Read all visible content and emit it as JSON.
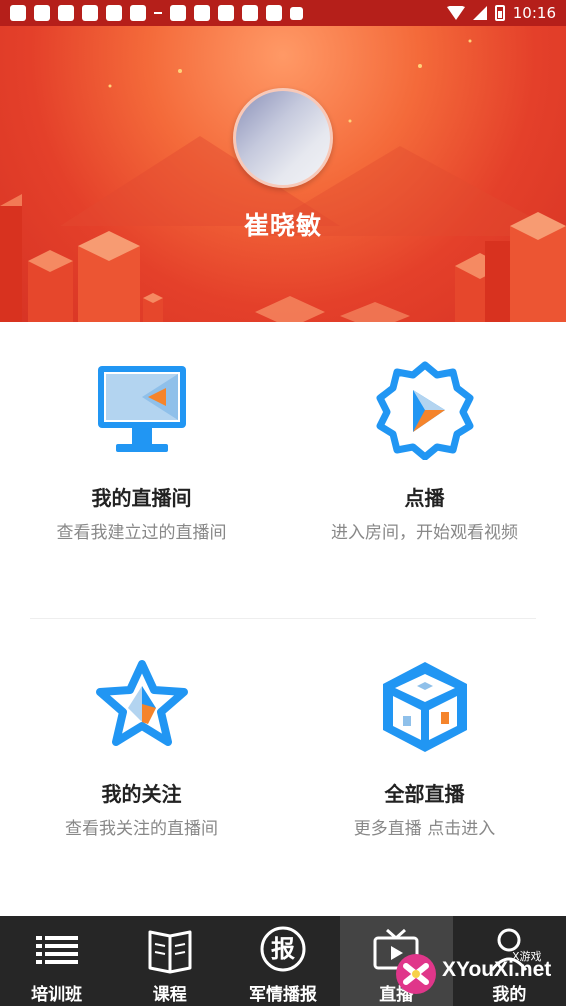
{
  "status_bar": {
    "time": "10:16"
  },
  "profile": {
    "user_name": "崔晓敏"
  },
  "grid": [
    {
      "title": "我的直播间",
      "subtitle": "查看我建立过的直播间",
      "icon": "monitor-icon"
    },
    {
      "title": "点播",
      "subtitle": "进入房间，开始观看视频",
      "icon": "play-badge-icon"
    },
    {
      "title": "我的关注",
      "subtitle": "查看我关注的直播间",
      "icon": "star-icon"
    },
    {
      "title": "全部直播",
      "subtitle": "更多直播 点击进入",
      "icon": "cube-icon"
    }
  ],
  "bottom_nav": [
    {
      "label": "培训班",
      "icon": "list-icon"
    },
    {
      "label": "课程",
      "icon": "book-icon"
    },
    {
      "label": "军情播报",
      "icon": "report-icon",
      "icon_glyph": "报"
    },
    {
      "label": "直播",
      "icon": "tv-icon",
      "active": true
    },
    {
      "label": "我的",
      "icon": "person-icon"
    }
  ],
  "watermark": {
    "text": "XYouXi.net",
    "small": "X游戏"
  },
  "colors": {
    "header_red": "#e4402a",
    "icon_blue": "#2196f3",
    "icon_orange": "#f5842b",
    "nav_bg": "#262626",
    "nav_active": "#444444"
  }
}
